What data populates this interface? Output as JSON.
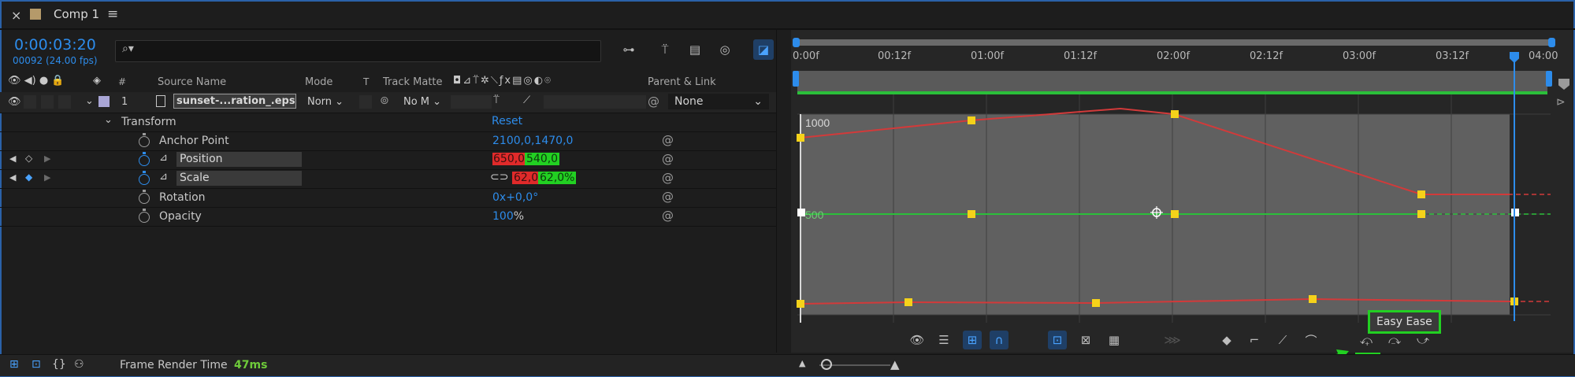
{
  "tab": {
    "close": "×",
    "title": "Comp 1",
    "menu": "≡"
  },
  "time": {
    "current": "0:00:03:20",
    "frames": "00092 (24.00 fps)"
  },
  "search": {
    "placeholder": ""
  },
  "columns": {
    "num": "#",
    "source_name": "Source Name",
    "mode": "Mode",
    "t": "T",
    "track_matte": "Track Matte",
    "parent_link": "Parent & Link"
  },
  "layer": {
    "number": "1",
    "name": "sunset-...ration_.eps",
    "mode": "Norn",
    "matte": "No M",
    "parent": "None"
  },
  "transform": {
    "label": "Transform",
    "reset": "Reset",
    "anchor_label": "Anchor Point",
    "anchor_value": "2100,0,1470,0",
    "position_label": "Position",
    "position_x": "650,0,",
    "position_y": "540,0",
    "scale_label": "Scale",
    "scale_x": "62,0,",
    "scale_y": "62,0%",
    "rotation_label": "Rotation",
    "rotation_value": "0x+0,0°",
    "opacity_label": "Opacity",
    "opacity_value": "100",
    "opacity_unit": "%"
  },
  "timeline": {
    "ticks": [
      "0:00f",
      "00:12f",
      "01:00f",
      "01:12f",
      "02:00f",
      "02:12f",
      "03:00f",
      "03:12f",
      "04:00"
    ],
    "graph_top_label": "1000",
    "graph_mid_label": "500"
  },
  "tooltip": {
    "label": "Easy Ease"
  },
  "status": {
    "label": "Frame Render Time",
    "value": "47ms"
  },
  "colors": {
    "accent": "#2d8ceb",
    "red_curve": "#d23a3a",
    "green_curve": "#2bbf3a",
    "keyframe": "#f5d21a",
    "highlight": "#22d022"
  }
}
